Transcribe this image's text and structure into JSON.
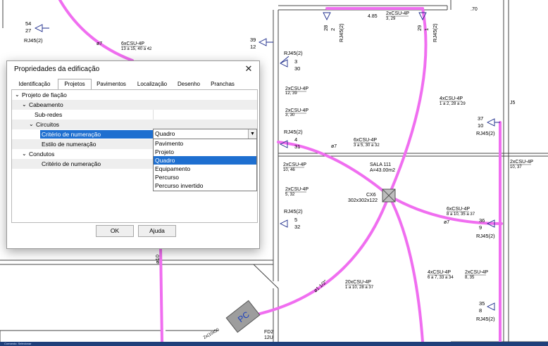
{
  "drawing": {
    "outlet_tag": "RJ45(2)",
    "dim_label": ".70",
    "dim_label2": "4.85",
    "wall_label": "J5",
    "angle_label": "ø7",
    "room_name": "SALA 111",
    "room_area": "A=43.00m2",
    "box_name": "CX6",
    "box_size": "302x302x122",
    "panel_label": "PC",
    "fd_label": "FD2",
    "fd_sub": "12U",
    "pipe_label": "ø1 1/2\"",
    "pipe_label2": "ø1\"",
    "vertical_label": "ø10",
    "bottom_label": "2x(10x50",
    "outlets": [
      {
        "top": "54",
        "bottom": "27"
      },
      {
        "top": "39",
        "bottom": "12"
      },
      {
        "top": "3",
        "bottom": "30"
      },
      {
        "top": "4",
        "bottom": "31"
      },
      {
        "top": "5",
        "bottom": "32"
      },
      {
        "top": "37",
        "bottom": "10"
      },
      {
        "top": "36",
        "bottom": "9"
      },
      {
        "top": "35",
        "bottom": "8"
      },
      {
        "top": "28",
        "bottom": "2"
      },
      {
        "top": "29",
        "bottom": "1"
      }
    ],
    "cables": [
      {
        "main": "6xCSU-4P",
        "sub": "13 a 15, 40 a 42"
      },
      {
        "main": "2xCSU-4P",
        "sub": "3, 29"
      },
      {
        "main": "2xCSU-4P",
        "sub": "12, 39"
      },
      {
        "main": "4xCSU-4P",
        "sub": "1 a 2, 28 a 29"
      },
      {
        "main": "2xCSU-4P",
        "sub": "3, 30"
      },
      {
        "main": "6xCSU-4P",
        "sub": "3 a 5, 30 a 32"
      },
      {
        "main": "2xCSU-4P",
        "sub": "10, 46"
      },
      {
        "main": "2xCSU-4P",
        "sub": "10, 37"
      },
      {
        "main": "2xCSU-4P",
        "sub": "5, 32"
      },
      {
        "main": "6xCSU-4P",
        "sub": "8 a 10, 35 a 37"
      },
      {
        "main": "20xCSU-4P",
        "sub": "1 a 10, 28 a 37"
      },
      {
        "main": "4xCSU-4P",
        "sub": "6 a 7, 33 a 34"
      },
      {
        "main": "2xCSU-4P",
        "sub": "8, 35"
      }
    ]
  },
  "dialog": {
    "title": "Propriedades da edificação",
    "close": "✕",
    "tabs": [
      "Identificação",
      "Projetos",
      "Pavimentos",
      "Localização",
      "Desenho",
      "Pranchas"
    ],
    "active_tab": "Projetos",
    "tree": [
      {
        "label": "Projeto de fiação"
      },
      {
        "label": "Cabeamento"
      },
      {
        "label": "Sub-redes"
      },
      {
        "label": "Circuitos"
      },
      {
        "label": "Critério de numeração"
      },
      {
        "label": "Estilo de numeração"
      },
      {
        "label": "Condutos"
      },
      {
        "label": "Critério de numeração"
      }
    ],
    "combo_value": "Quadro",
    "options": [
      "Pavimento",
      "Projeto",
      "Quadro",
      "Equipamento",
      "Percurso",
      "Percurso invertido"
    ],
    "selected_option": "Quadro",
    "ok": "OK",
    "help": "Ajuda"
  },
  "statusbar": {
    "text": "Comando: Selecionar"
  },
  "colors": {
    "cable": "#f06ef0",
    "selection": "#1e6fd0"
  }
}
